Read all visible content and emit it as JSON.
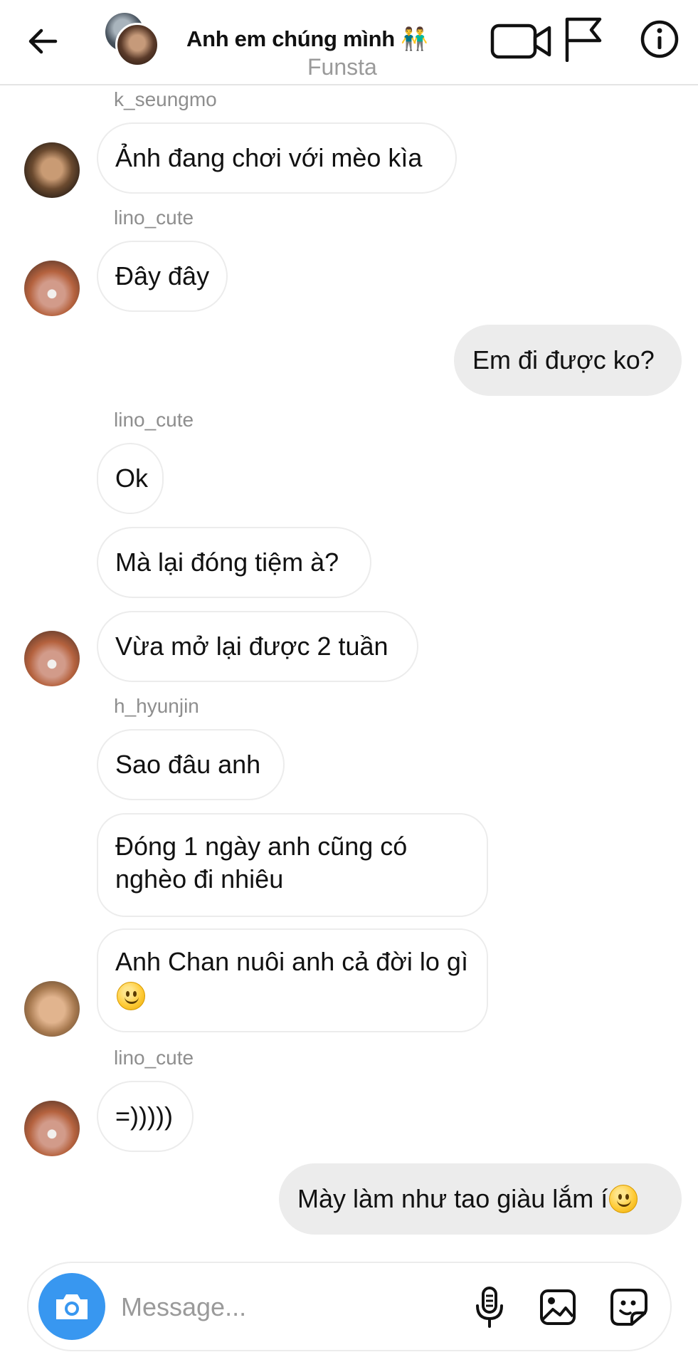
{
  "header": {
    "title": "Anh em chúng mình 👬",
    "subtitle": "Funsta",
    "icons": {
      "back": "arrow-left-icon",
      "video": "video-camera-icon",
      "flag": "flag-icon",
      "info": "info-icon"
    }
  },
  "messages": [
    {
      "kind": "sender",
      "text": "k_seungmo"
    },
    {
      "kind": "incoming",
      "text": "Ảnh đang chơi với mèo kìa",
      "avatar": "k_seungmo"
    },
    {
      "kind": "sender",
      "text": "lino_cute"
    },
    {
      "kind": "incoming",
      "text": "Đây đây",
      "avatar": "lino_cute"
    },
    {
      "kind": "outgoing",
      "text": "Em đi được ko?"
    },
    {
      "kind": "sender",
      "text": "lino_cute"
    },
    {
      "kind": "incoming",
      "text": "Ok"
    },
    {
      "kind": "incoming",
      "text": "Mà lại đóng tiệm à?"
    },
    {
      "kind": "incoming",
      "text": "Vừa mở lại được 2 tuần",
      "avatar": "lino_cute"
    },
    {
      "kind": "sender",
      "text": "h_hyunjin"
    },
    {
      "kind": "incoming",
      "text": "Sao đâu anh"
    },
    {
      "kind": "incoming",
      "text": "Đóng 1 ngày anh cũng có nghèo đi nhiêu"
    },
    {
      "kind": "incoming",
      "text": "Anh Chan nuôi anh cả đời lo gì",
      "emoji": "slightly-smiling-face-emoji",
      "avatar": "h_hyunjin"
    },
    {
      "kind": "sender",
      "text": "lino_cute"
    },
    {
      "kind": "incoming",
      "text": "=)))))",
      "avatar": "lino_cute"
    },
    {
      "kind": "outgoing",
      "text": "Mày làm như tao giàu lắm í",
      "emoji": "slightly-smiling-face-emoji"
    }
  ],
  "composer": {
    "placeholder": "Message...",
    "value": "",
    "icons": {
      "camera": "camera-icon",
      "mic": "microphone-icon",
      "gallery": "image-gallery-icon",
      "sticker": "sticker-icon"
    }
  },
  "colors": {
    "accent": "#3897f0",
    "outgoing_bubble": "#ececec",
    "incoming_border": "#ececec",
    "muted_text": "#8e8e8e"
  }
}
